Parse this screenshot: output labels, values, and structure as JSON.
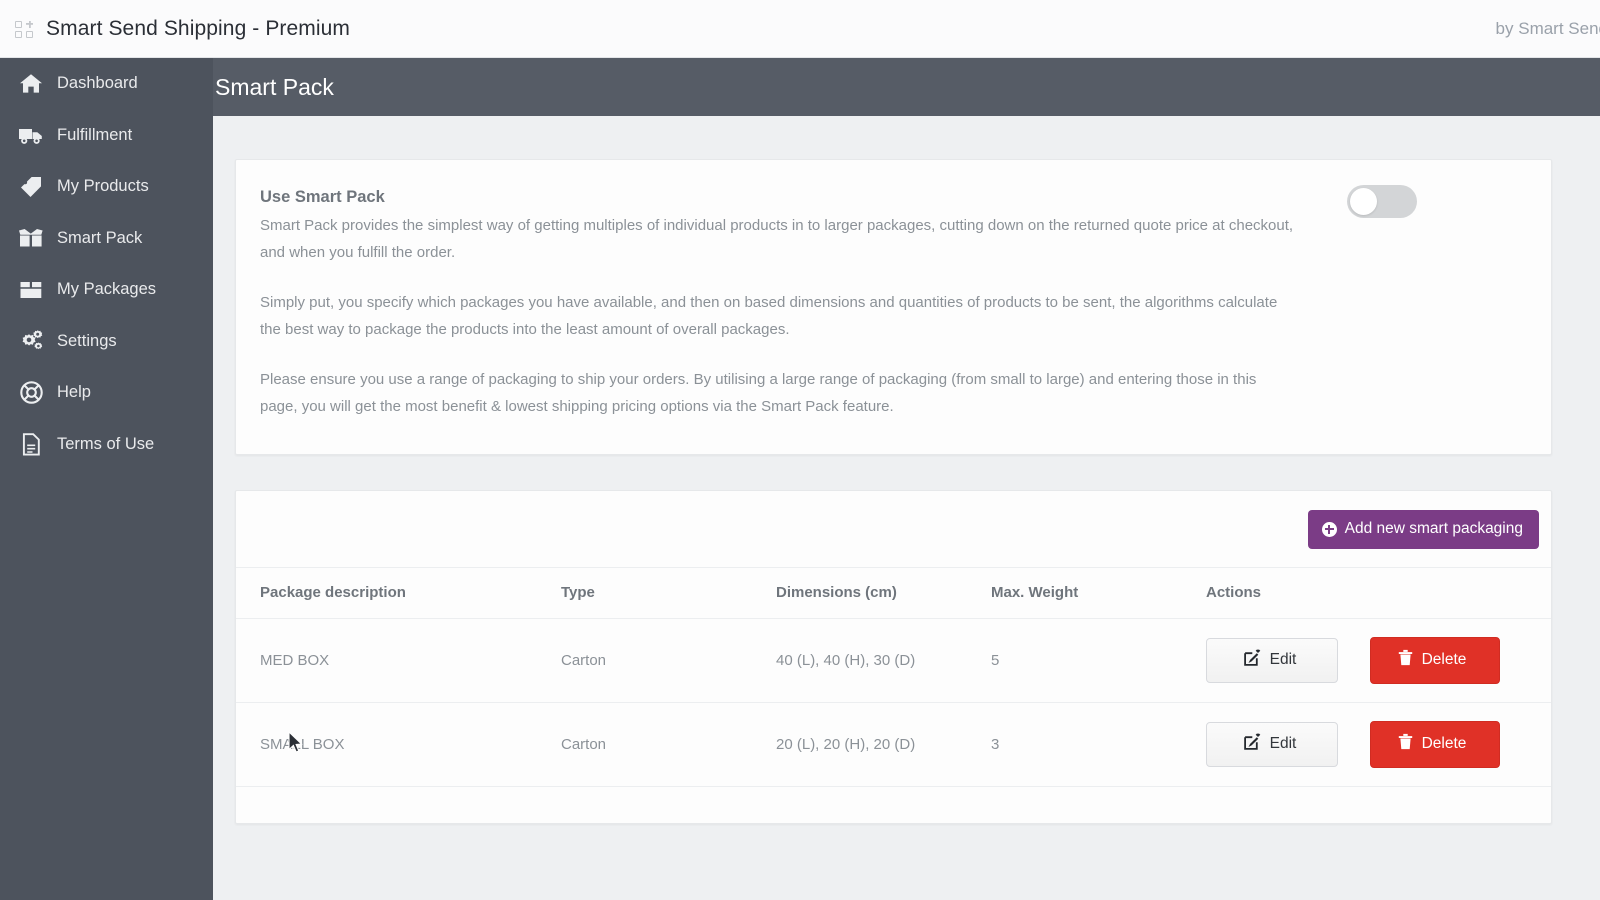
{
  "topbar": {
    "app_icon": "app-grid-plus-icon",
    "title": "Smart Send Shipping - Premium",
    "vendor": "by Smart Send"
  },
  "sidebar": {
    "items": [
      {
        "label": "Dashboard",
        "icon": "home-icon"
      },
      {
        "label": "Fulfillment",
        "icon": "truck-icon"
      },
      {
        "label": "My Products",
        "icon": "tag-icon"
      },
      {
        "label": "Smart Pack",
        "icon": "open-box-icon"
      },
      {
        "label": "My Packages",
        "icon": "closed-box-icon"
      },
      {
        "label": "Settings",
        "icon": "gears-icon"
      },
      {
        "label": "Help",
        "icon": "lifebuoy-icon"
      },
      {
        "label": "Terms of Use",
        "icon": "document-icon"
      }
    ]
  },
  "page": {
    "title": "Smart Pack"
  },
  "description_card": {
    "heading": "Use Smart Pack",
    "paragraphs": [
      "Smart Pack provides the simplest way of getting multiples of individual products in to larger packages, cutting down on the returned quote price at checkout, and when you fulfill the order.",
      "Simply put, you specify which packages you have available, and then on based dimensions and quantities of products to be sent, the algorithms calculate the best way to package the products into the least amount of overall packages.",
      "Please ensure you use a range of packaging to ship your orders. By utilising a large range of packaging (from small to large) and entering those in this page, you will get the most benefit & lowest shipping pricing options via the Smart Pack feature."
    ],
    "toggle": {
      "name": "use-smart-pack-toggle",
      "state": "off"
    }
  },
  "packaging_card": {
    "add_button": {
      "label": "Add new smart packaging",
      "icon": "plus-circle-icon"
    },
    "table": {
      "columns": [
        "Package description",
        "Type",
        "Dimensions (cm)",
        "Max. Weight",
        "Actions"
      ],
      "rows": [
        {
          "description": "MED BOX",
          "type": "Carton",
          "dimensions": "40 (L), 40 (H), 30 (D)",
          "max_weight": "5",
          "edit_label": "Edit",
          "delete_label": "Delete"
        },
        {
          "description": "SMALL BOX",
          "type": "Carton",
          "dimensions": "20 (L), 20 (H), 20 (D)",
          "max_weight": "3",
          "edit_label": "Edit",
          "delete_label": "Delete"
        }
      ]
    }
  },
  "colors": {
    "sidebar": "#4d535d",
    "page_header": "#565c66",
    "accent_purple": "#7b3c86",
    "danger_red": "#e03127",
    "content_bg": "#eef0f2"
  }
}
